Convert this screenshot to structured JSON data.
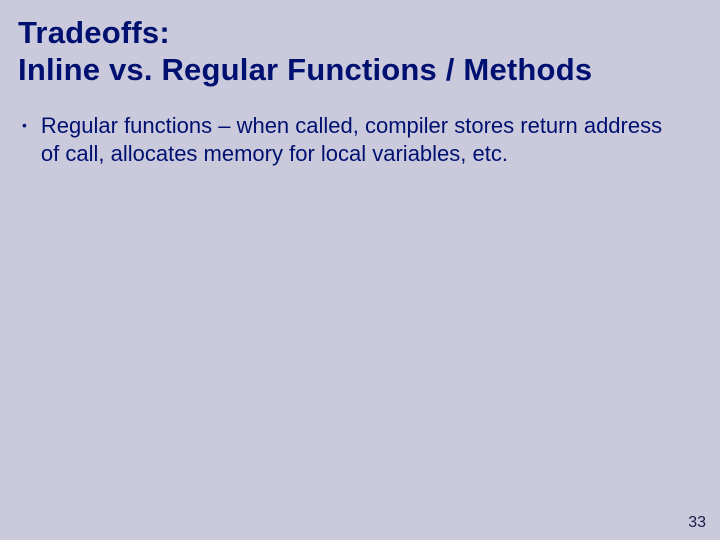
{
  "title_line1": "Tradeoffs:",
  "title_line2": "Inline vs. Regular Functions / Methods",
  "bullets": [
    "Regular functions – when called, compiler stores return address of call, allocates memory for local variables, etc."
  ],
  "page_number": "33"
}
